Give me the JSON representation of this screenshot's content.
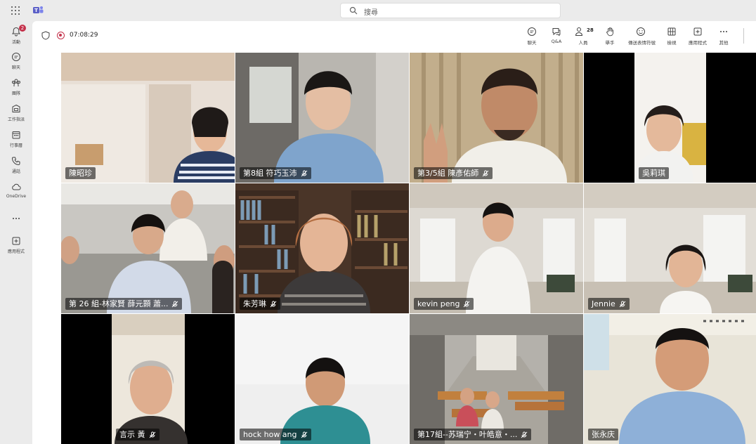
{
  "app": {
    "search_placeholder": "搜尋"
  },
  "rail": {
    "items": [
      {
        "label": "活動",
        "icon": "bell-icon",
        "badge": "2"
      },
      {
        "label": "聊天",
        "icon": "chat-icon"
      },
      {
        "label": "團隊",
        "icon": "teams-icon"
      },
      {
        "label": "工作指派",
        "icon": "assignments-icon"
      },
      {
        "label": "行事曆",
        "icon": "calendar-icon"
      },
      {
        "label": "通話",
        "icon": "phone-icon"
      },
      {
        "label": "OneDrive",
        "icon": "cloud-icon"
      },
      {
        "label": "",
        "icon": "more-icon"
      },
      {
        "label": "應用程式",
        "icon": "apps-icon"
      }
    ]
  },
  "meeting": {
    "timer": "07:08:29",
    "people_count": "28",
    "tools": [
      {
        "label": "聊天",
        "icon": "chat-icon"
      },
      {
        "label": "Q&A",
        "icon": "qa-icon"
      },
      {
        "label": "人員",
        "icon": "people-icon"
      },
      {
        "label": "舉手",
        "icon": "raise-hand-icon"
      },
      {
        "label": "傳送表情符號",
        "icon": "emoji-icon"
      },
      {
        "label": "檢視",
        "icon": "view-icon"
      },
      {
        "label": "應用程式",
        "icon": "add-app-icon"
      },
      {
        "label": "其他",
        "icon": "more-icon"
      }
    ]
  },
  "participants": [
    {
      "name": "陳昭珍"
    },
    {
      "name": "第8組 符巧玉沛"
    },
    {
      "name": "第3/5組 陳彥佑師"
    },
    {
      "name": "吳莉琪"
    },
    {
      "name": "第 26 組-林家賢 薛元顥 蕭..."
    },
    {
      "name": "朱芳琳"
    },
    {
      "name": "kevin peng"
    },
    {
      "name": "Jennie"
    },
    {
      "name": "言示 黃"
    },
    {
      "name": "hock how ang"
    },
    {
      "name": "第17組--苏瑞宁・叶皓意・..."
    },
    {
      "name": "张永庆"
    }
  ],
  "colors": {
    "accent": "#5b5fc7",
    "recording": "#c4314b"
  }
}
